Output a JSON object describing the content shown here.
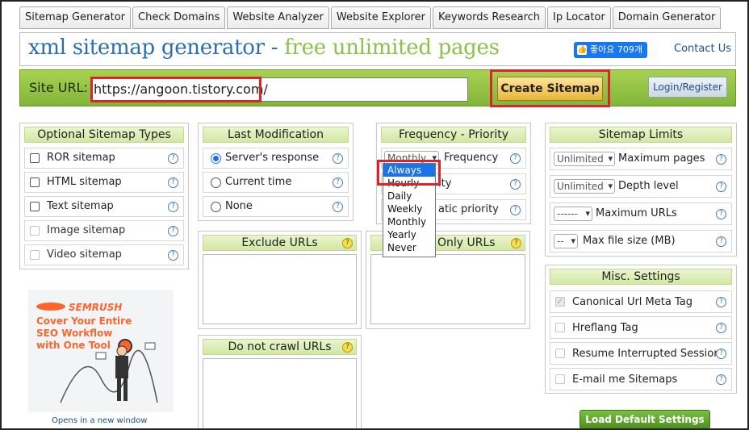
{
  "nav": {
    "items": [
      "Sitemap Generator",
      "Check Domains",
      "Website Analyzer",
      "Website Explorer",
      "Keywords Research",
      "Ip Locator",
      "Domain Generator"
    ]
  },
  "header": {
    "title_part1": "xml sitemap generator - ",
    "title_part2": "free unlimited pages",
    "like_label": "좋아요 709개",
    "contact_label": "Contact Us"
  },
  "urlbar": {
    "label": "Site URL:",
    "url_value": "https://angoon.tistory.com/",
    "create_label": "Create Sitemap",
    "login_label": "Login/Register"
  },
  "sitemap_types": {
    "title": "Optional Sitemap Types",
    "items": [
      {
        "label": "ROR sitemap",
        "checked": false,
        "disabled": false
      },
      {
        "label": "HTML sitemap",
        "checked": false,
        "disabled": false
      },
      {
        "label": "Text sitemap",
        "checked": false,
        "disabled": false
      },
      {
        "label": "Image sitemap",
        "checked": false,
        "disabled": true
      },
      {
        "label": "Video sitemap",
        "checked": false,
        "disabled": true
      }
    ]
  },
  "last_mod": {
    "title": "Last Modification",
    "options": [
      "Server's response",
      "Current time",
      "None"
    ],
    "selected": "Server's response"
  },
  "freq": {
    "title": "Frequency - Priority",
    "select_value": "Monthly",
    "row1_label": "Frequency",
    "row2_label": "ity",
    "row3_label": "atic priority",
    "dropdown_options": [
      "Always",
      "Hourly",
      "Daily",
      "Weekly",
      "Monthly",
      "Yearly",
      "Never"
    ],
    "highlighted": "Always"
  },
  "limits": {
    "title": "Sitemap Limits",
    "rows": [
      {
        "select": "Unlimited",
        "label": "Maximum pages"
      },
      {
        "select": "Unlimited",
        "label": "Depth level"
      },
      {
        "select": "------",
        "label": "Maximum URLs"
      },
      {
        "select": "--",
        "label": "Max file size (MB)"
      }
    ]
  },
  "exclude": {
    "title": "Exclude URLs"
  },
  "include": {
    "title": "Only URLs"
  },
  "nocrawl": {
    "title": "Do not crawl URLs"
  },
  "misc": {
    "title": "Misc. Settings",
    "items": [
      {
        "label": "Canonical Url Meta Tag",
        "checked": true
      },
      {
        "label": "Hreflang Tag",
        "checked": false
      },
      {
        "label": "Resume Interrupted Session",
        "checked": false
      },
      {
        "label": "E-mail me Sitemaps",
        "checked": false
      }
    ],
    "default_label": "Load Default Settings"
  },
  "ad": {
    "brand": "SEMRUSH",
    "headline": "Cover Your Entire SEO Workflow with One Tool",
    "caption": "Opens in a new window"
  },
  "colors": {
    "accent_green": "#8bc34a",
    "title_blue": "#2a6fb6",
    "highlight_red": "#d9252b",
    "semrush_orange": "#ff642d"
  }
}
